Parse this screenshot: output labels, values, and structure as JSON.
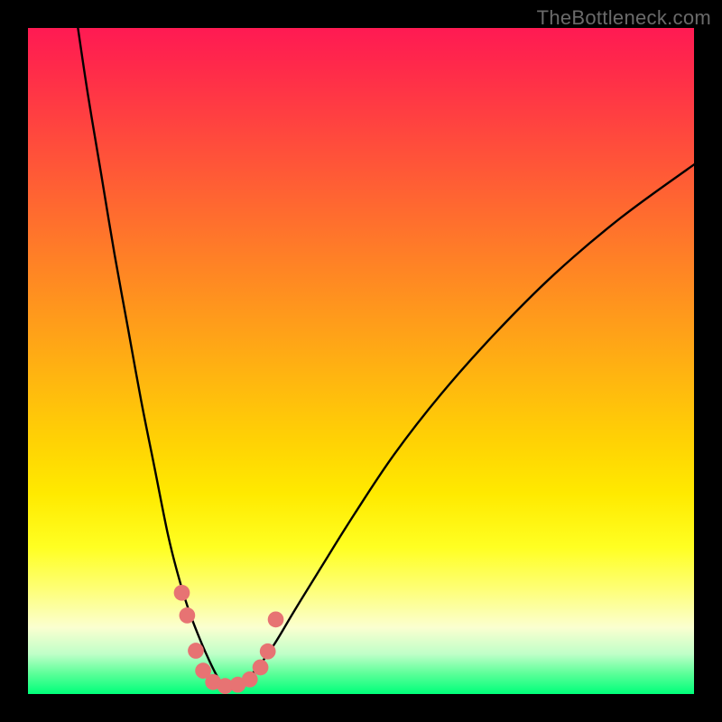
{
  "watermark": "TheBottleneck.com",
  "colors": {
    "background_frame": "#000000",
    "curve": "#000000",
    "marker": "#e77373",
    "gradient_top": "#ff1a53",
    "gradient_mid": "#ffea00",
    "gradient_bottom": "#00ff7a"
  },
  "chart_data": {
    "type": "line",
    "title": "",
    "xlabel": "",
    "ylabel": "",
    "note": "Axes are unlabeled; x and y read as fraction of plot area (0–1, origin top-left). Two curves descend from the top edge to a shared minimum near the bottom then one continues upward to the right. Salmon markers sit near the trough.",
    "xlim": [
      0,
      1
    ],
    "ylim": [
      0,
      1
    ],
    "series": [
      {
        "name": "left-curve",
        "x": [
          0.075,
          0.09,
          0.11,
          0.13,
          0.15,
          0.17,
          0.19,
          0.21,
          0.225,
          0.24,
          0.255,
          0.27,
          0.285,
          0.3
        ],
        "y": [
          0.0,
          0.1,
          0.22,
          0.34,
          0.45,
          0.56,
          0.66,
          0.76,
          0.82,
          0.87,
          0.91,
          0.945,
          0.975,
          0.995
        ]
      },
      {
        "name": "right-curve",
        "x": [
          0.3,
          0.32,
          0.345,
          0.37,
          0.4,
          0.44,
          0.49,
          0.55,
          0.62,
          0.7,
          0.79,
          0.89,
          1.0
        ],
        "y": [
          0.995,
          0.985,
          0.96,
          0.925,
          0.875,
          0.81,
          0.73,
          0.64,
          0.55,
          0.46,
          0.37,
          0.285,
          0.205
        ]
      }
    ],
    "markers": {
      "name": "trough-markers",
      "points": [
        {
          "x": 0.231,
          "y": 0.848
        },
        {
          "x": 0.239,
          "y": 0.882
        },
        {
          "x": 0.252,
          "y": 0.935
        },
        {
          "x": 0.263,
          "y": 0.965
        },
        {
          "x": 0.278,
          "y": 0.982
        },
        {
          "x": 0.296,
          "y": 0.988
        },
        {
          "x": 0.315,
          "y": 0.986
        },
        {
          "x": 0.333,
          "y": 0.978
        },
        {
          "x": 0.349,
          "y": 0.96
        },
        {
          "x": 0.36,
          "y": 0.936
        },
        {
          "x": 0.372,
          "y": 0.888
        }
      ],
      "radius_frac": 0.012
    }
  }
}
